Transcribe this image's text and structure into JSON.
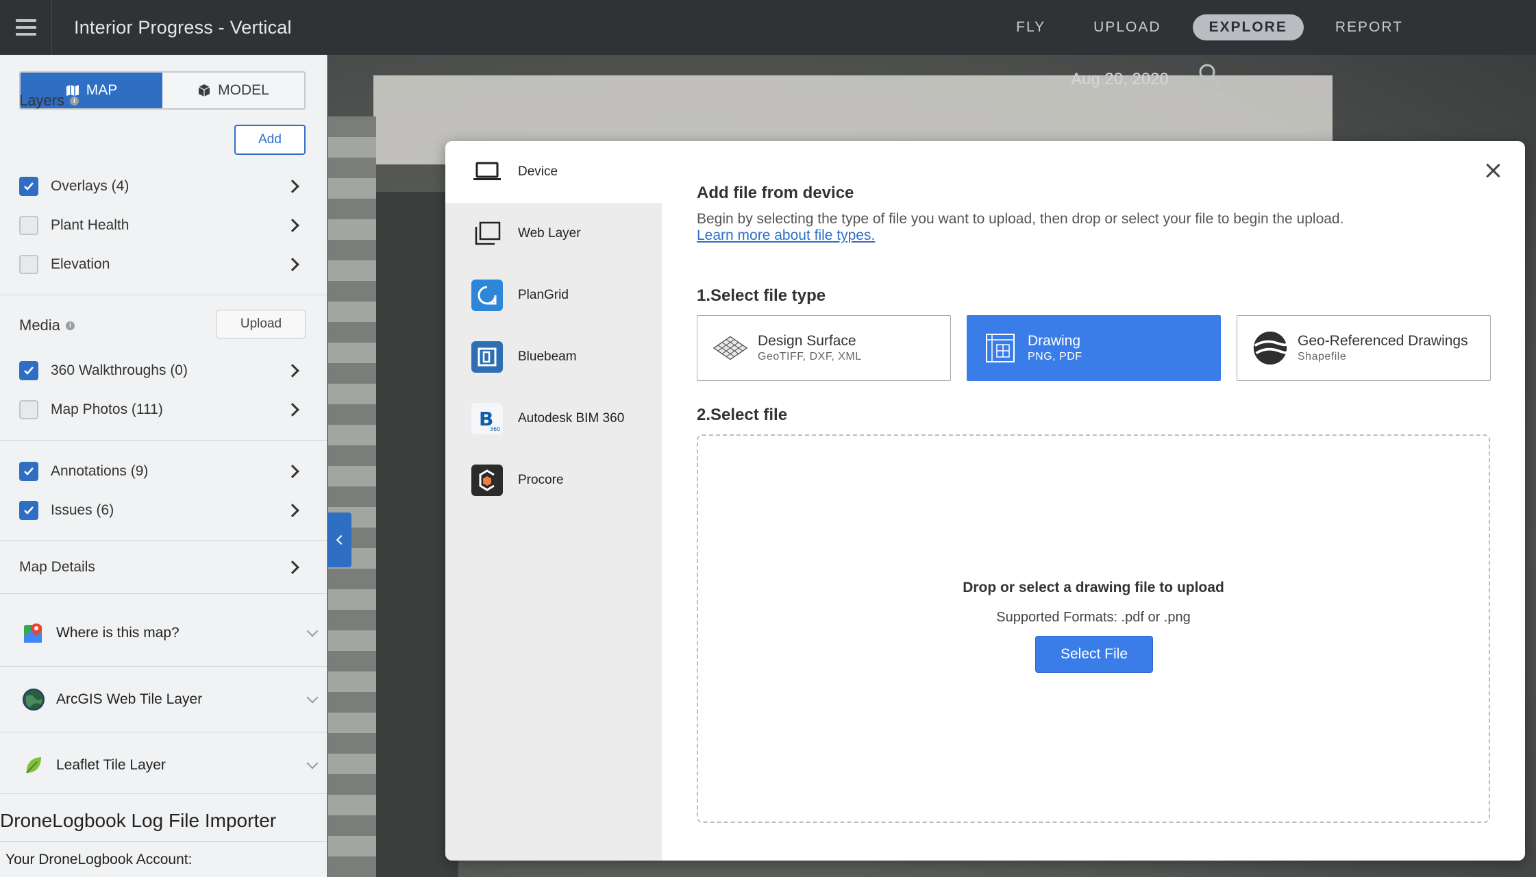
{
  "header": {
    "title": "Interior Progress - Vertical",
    "nav": [
      {
        "label": "FLY",
        "active": false
      },
      {
        "label": "UPLOAD",
        "active": false
      },
      {
        "label": "EXPLORE",
        "active": true
      },
      {
        "label": "REPORT",
        "active": false
      }
    ]
  },
  "sidebar": {
    "view_toggle": {
      "map_label": "MAP",
      "model_label": "MODEL",
      "selected": "MAP"
    },
    "layers": {
      "title": "Layers",
      "add_label": "Add",
      "items": [
        {
          "label": "Overlays (4)",
          "checked": true
        },
        {
          "label": "Plant Health",
          "checked": false
        },
        {
          "label": "Elevation",
          "checked": false
        }
      ]
    },
    "media": {
      "title": "Media",
      "upload_label": "Upload",
      "items": [
        {
          "label": "360 Walkthroughs (0)",
          "checked": true
        },
        {
          "label": "Map Photos (111)",
          "checked": false
        }
      ]
    },
    "extra": [
      {
        "label": "Annotations (9)",
        "checked": true
      },
      {
        "label": "Issues (6)",
        "checked": true
      }
    ],
    "map_details": "Map Details",
    "plugins": [
      {
        "label": "Where is this map?",
        "icon": "google-maps-icon"
      },
      {
        "label": "ArcGIS Web Tile Layer",
        "icon": "globe-icon"
      },
      {
        "label": "Leaflet Tile Layer",
        "icon": "leaf-icon"
      }
    ],
    "importer": {
      "title": "DroneLogbook Log File Importer",
      "account_label": "Your DroneLogbook Account:"
    }
  },
  "map": {
    "date": "Aug 20, 2020",
    "inspect_label": "Inspect"
  },
  "modal": {
    "sources": [
      {
        "label": "Device",
        "icon": "laptop-icon",
        "active": true
      },
      {
        "label": "Web Layer",
        "icon": "layers-icon",
        "active": false
      },
      {
        "label": "PlanGrid",
        "icon": "plangrid-icon",
        "active": false
      },
      {
        "label": "Bluebeam",
        "icon": "bluebeam-icon",
        "active": false
      },
      {
        "label": "Autodesk BIM 360",
        "icon": "bim360-icon",
        "active": false
      },
      {
        "label": "Procore",
        "icon": "procore-icon",
        "active": false
      }
    ],
    "title": "Add file from device",
    "description": "Begin by selecting the type of file you want to upload, then drop or select your file to begin the upload.",
    "learn_more": "Learn more about file types.",
    "step1": "1.Select file type",
    "file_types": [
      {
        "name": "Design Surface",
        "formats": "GeoTIFF, DXF, XML",
        "selected": false
      },
      {
        "name": "Drawing",
        "formats": "PNG, PDF",
        "selected": true
      },
      {
        "name": "Geo-Referenced Drawings",
        "formats": "Shapefile",
        "selected": false
      }
    ],
    "step2": "2.Select file",
    "dropzone": {
      "title": "Drop or select a drawing file to upload",
      "formats": "Supported Formats: .pdf or .png",
      "button": "Select File"
    }
  },
  "colors": {
    "accent": "#2e6fc4",
    "selected_tile": "#3a7de8",
    "topbar": "#303236"
  }
}
